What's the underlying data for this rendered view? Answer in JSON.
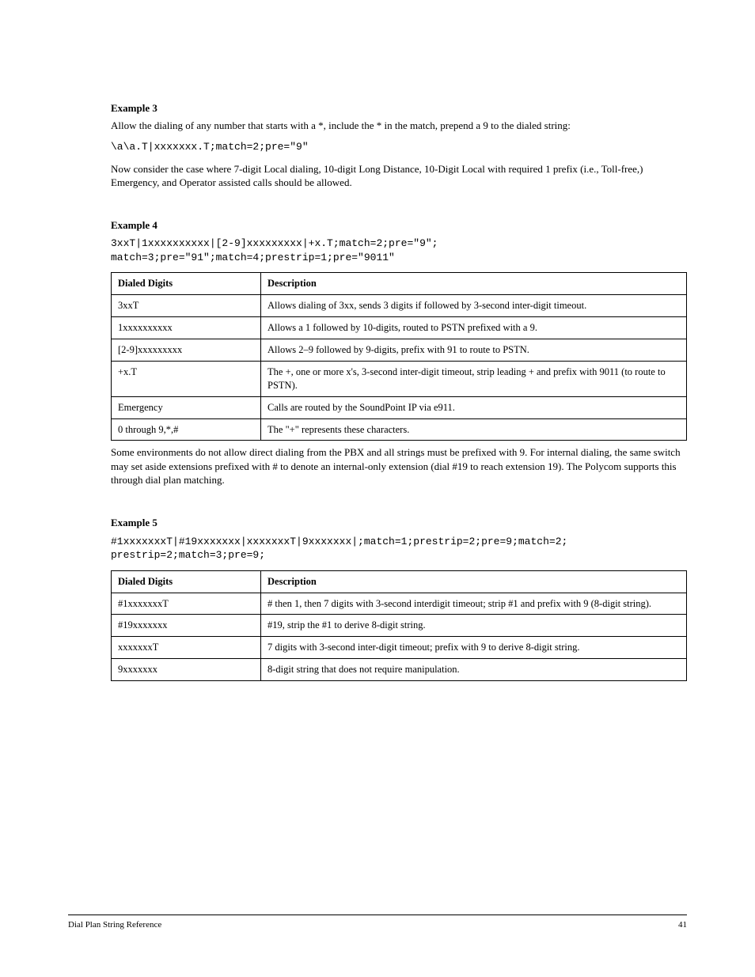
{
  "ex3": {
    "heading": "Example 3",
    "intro": "Allow the dialing of any number that starts with a *, include the * in the match, prepend a 9 to the dialed string:",
    "code": "\\a\\a.T|xxxxxxx.T;match=2;pre=\"9\"",
    "after": "Now consider the case where 7-digit Local dialing, 10-digit Long Distance, 10-Digit Local with required 1 prefix (i.e., Toll-free,) Emergency, and Operator assisted calls should be allowed."
  },
  "ex4": {
    "heading": "Example 4",
    "intro": "",
    "code": "3xxT|1xxxxxxxxxx|[2-9]xxxxxxxxx|+x.T;match=2;pre=\"9\";\nmatch=3;pre=\"91\";match=4;prestrip=1;pre=\"9011\"",
    "table": [
      [
        "Dialed Digits",
        "Description"
      ],
      [
        "3xxT",
        "Allows dialing of 3xx, sends 3 digits if followed by 3-second inter-digit timeout."
      ],
      [
        "1xxxxxxxxxx",
        "Allows a 1 followed by 10-digits, routed to PSTN prefixed with a 9."
      ],
      [
        "[2-9]xxxxxxxxx",
        "Allows 2–9 followed by 9-digits, prefix with 91 to route to PSTN."
      ],
      [
        "+x.T",
        "The +, one or more x's, 3-second inter-digit timeout, strip leading + and prefix with 9011 (to route to PSTN)."
      ],
      [
        "Emergency",
        "Calls are routed by the SoundPoint IP via e911."
      ],
      [
        "0 through 9,*,#",
        "The \"+\" represents these characters."
      ]
    ],
    "after": "Some environments do not allow direct dialing from the PBX and all strings must be prefixed with 9. For internal dialing, the same switch may set aside extensions prefixed with # to denote an internal-only extension (dial #19 to reach extension 19). The Polycom supports this through dial plan matching."
  },
  "ex5": {
    "heading": "Example 5",
    "intro": "",
    "code": "#1xxxxxxxT|#19xxxxxxx|xxxxxxxT|9xxxxxxx|;match=1;prestrip=2;pre=9;match=2;\nprestrip=2;match=3;pre=9;",
    "table": [
      [
        "Dialed Digits",
        "Description"
      ],
      [
        "#1xxxxxxxT",
        "# then 1, then 7 digits with 3-second interdigit timeout; strip #1 and prefix with 9 (8-digit string)."
      ],
      [
        "#19xxxxxxx",
        "#19, strip the #1 to derive 8-digit string."
      ],
      [
        "xxxxxxxT",
        "7 digits with 3-second inter-digit timeout; prefix with 9 to derive 8-digit string."
      ],
      [
        "9xxxxxxx",
        "8-digit string that does not require manipulation."
      ]
    ]
  },
  "footer": {
    "left": "Dial Plan String Reference",
    "right": "41"
  }
}
